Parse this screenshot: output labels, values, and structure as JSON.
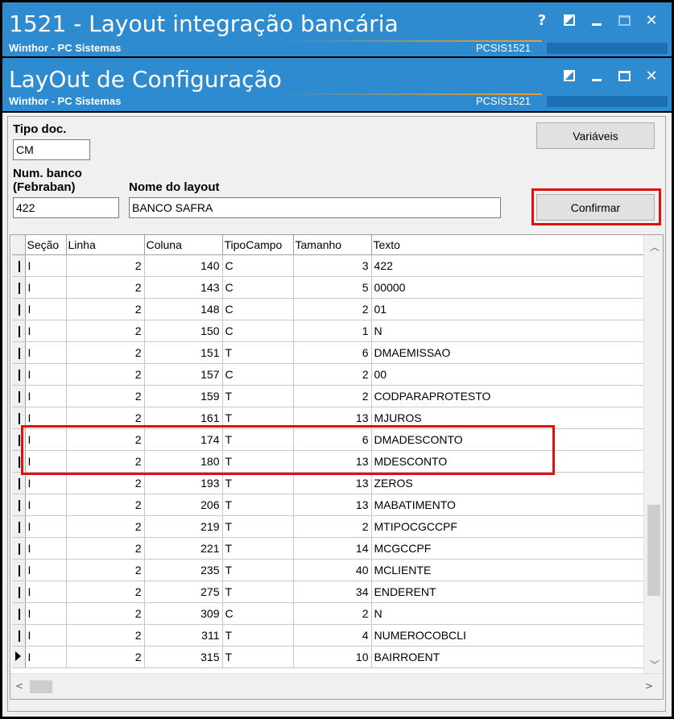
{
  "outer_window": {
    "title": "1521 - Layout integração bancária",
    "subtitle": "Winthor - PC Sistemas",
    "code": "PCSIS1521",
    "buttons": {
      "help": "?",
      "close": "✕"
    }
  },
  "inner_window": {
    "title": "LayOut de Configuração",
    "subtitle": "Winthor - PC Sistemas",
    "code": "PCSIS1521",
    "buttons": {
      "close": "✕"
    }
  },
  "form": {
    "tipo_doc_label": "Tipo doc.",
    "tipo_doc_value": "CM",
    "num_banco_label_1": "Num. banco",
    "num_banco_label_2": "(Febraban)",
    "num_banco_value": "422",
    "nome_layout_label": "Nome do layout",
    "nome_layout_value": "BANCO SAFRA",
    "variaveis_label": "Variáveis",
    "confirmar_label": "Confirmar",
    "highlight_color": "#e01010"
  },
  "grid": {
    "columns": [
      "Seção",
      "Linha",
      "Coluna",
      "TipoCampo",
      "Tamanho",
      "Texto"
    ],
    "rows": [
      [
        "I",
        "2",
        "140",
        "C",
        "3",
        "422"
      ],
      [
        "I",
        "2",
        "143",
        "C",
        "5",
        "00000"
      ],
      [
        "I",
        "2",
        "148",
        "C",
        "2",
        "01"
      ],
      [
        "I",
        "2",
        "150",
        "C",
        "1",
        "N"
      ],
      [
        "I",
        "2",
        "151",
        "T",
        "6",
        "DMAEMISSAO"
      ],
      [
        "I",
        "2",
        "157",
        "C",
        "2",
        "00"
      ],
      [
        "I",
        "2",
        "159",
        "T",
        "2",
        "CODPARAPROTESTO"
      ],
      [
        "I",
        "2",
        "161",
        "T",
        "13",
        "MJUROS"
      ],
      [
        "I",
        "2",
        "174",
        "T",
        "6",
        "DMADESCONTO"
      ],
      [
        "I",
        "2",
        "180",
        "T",
        "13",
        "MDESCONTO"
      ],
      [
        "I",
        "2",
        "193",
        "T",
        "13",
        "ZEROS"
      ],
      [
        "I",
        "2",
        "206",
        "T",
        "13",
        "MABATIMENTO"
      ],
      [
        "I",
        "2",
        "219",
        "T",
        "2",
        "MTIPOCGCCPF"
      ],
      [
        "I",
        "2",
        "221",
        "T",
        "14",
        "MCGCCPF"
      ],
      [
        "I",
        "2",
        "235",
        "T",
        "40",
        "MCLIENTE"
      ],
      [
        "I",
        "2",
        "275",
        "T",
        "34",
        "ENDERENT"
      ],
      [
        "I",
        "2",
        "309",
        "C",
        "2",
        " N"
      ],
      [
        "I",
        "2",
        "311",
        "T",
        "4",
        "NUMEROCOBCLI"
      ],
      [
        "I",
        "2",
        "315",
        "T",
        "10",
        "BAIRROENT"
      ]
    ],
    "current_row_index": 18
  }
}
